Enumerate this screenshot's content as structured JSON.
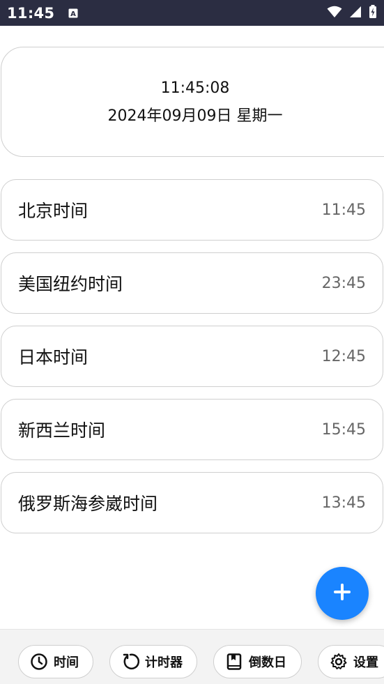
{
  "status_bar": {
    "time": "11:45",
    "left_icon": "a-badge-icon",
    "right_icons": [
      "wifi-icon",
      "signal-icon",
      "battery-charging-icon"
    ]
  },
  "clock_card": {
    "time": "11:45:08",
    "date": "2024年09月09日 星期一"
  },
  "timezones": [
    {
      "label": "北京时间",
      "time": "11:45"
    },
    {
      "label": "美国纽约时间",
      "time": "23:45"
    },
    {
      "label": "日本时间",
      "time": "12:45"
    },
    {
      "label": "新西兰时间",
      "time": "15:45"
    },
    {
      "label": "俄罗斯海参崴时间",
      "time": "13:45"
    }
  ],
  "fab": {
    "icon": "plus-icon"
  },
  "bottom_nav": [
    {
      "label": "时间",
      "icon": "clock-icon"
    },
    {
      "label": "计时器",
      "icon": "refresh-icon"
    },
    {
      "label": "倒数日",
      "icon": "bookmark-book-icon"
    },
    {
      "label": "设置",
      "icon": "gear-icon"
    }
  ],
  "colors": {
    "status_bar": "#2b2d42",
    "accent": "#1a84ff",
    "card_border": "#cfcfcf",
    "secondary_text": "#666666"
  }
}
